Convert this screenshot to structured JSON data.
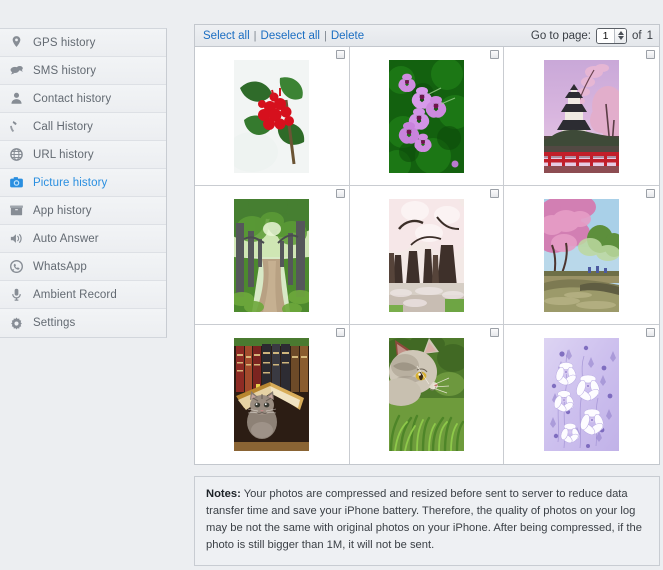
{
  "sidebar": {
    "items": [
      {
        "label": "GPS history",
        "icon": "map-pin-icon",
        "active": false
      },
      {
        "label": "SMS history",
        "icon": "chat-bubble-icon",
        "active": false
      },
      {
        "label": "Contact history",
        "icon": "person-icon",
        "active": false
      },
      {
        "label": "Call History",
        "icon": "phone-icon",
        "active": false
      },
      {
        "label": "URL history",
        "icon": "globe-icon",
        "active": false
      },
      {
        "label": "Picture history",
        "icon": "camera-icon",
        "active": true
      },
      {
        "label": "App history",
        "icon": "app-box-icon",
        "active": false
      },
      {
        "label": "Auto Answer",
        "icon": "speaker-icon",
        "active": false
      },
      {
        "label": "WhatsApp",
        "icon": "whatsapp-icon",
        "active": false
      },
      {
        "label": "Ambient Record",
        "icon": "microphone-icon",
        "active": false
      },
      {
        "label": "Settings",
        "icon": "gear-icon",
        "active": false
      }
    ],
    "active_color": "#2a8fe0"
  },
  "toolbar": {
    "select_all": "Select all",
    "deselect_all": "Deselect all",
    "delete": "Delete",
    "separator": "|",
    "goto_label": "Go to page:",
    "page_value": "1",
    "of_label": "of",
    "total_pages": "1",
    "link_color": "#1b6ec2"
  },
  "gallery": {
    "columns": 3,
    "rows": 3,
    "photos": [
      {
        "alt": "Red berries with green holly leaves in snow",
        "checked": false,
        "scene": "holly-berries"
      },
      {
        "alt": "Purple flowers over green foliage",
        "checked": false,
        "scene": "purple-flowers"
      },
      {
        "alt": "Japanese castle with cherry blossoms and red bridge",
        "checked": false,
        "scene": "castle-sakura"
      },
      {
        "alt": "Tree lined forest path in green woodland",
        "checked": false,
        "scene": "forest-path"
      },
      {
        "alt": "White cherry blossom trees over pathway",
        "checked": false,
        "scene": "white-sakura"
      },
      {
        "alt": "Pink cherry blossom tree beside water",
        "checked": false,
        "scene": "pink-sakura-water"
      },
      {
        "alt": "Kitten sheltering under an open book on a shelf",
        "checked": false,
        "scene": "kitten-books"
      },
      {
        "alt": "Grey tabby cat in green grass",
        "checked": false,
        "scene": "cat-grass"
      },
      {
        "alt": "White and purple floral pattern on lavender",
        "checked": false,
        "scene": "lilac-pattern"
      }
    ]
  },
  "notes": {
    "label": "Notes:",
    "text": " Your photos are compressed and resized before sent to server to reduce data transfer time and save your iPhone battery. Therefore, the quality of photos on your log may be not the same with original photos on your iPhone. After being compressed, if the photo is still bigger than 1M, it will not be sent."
  }
}
